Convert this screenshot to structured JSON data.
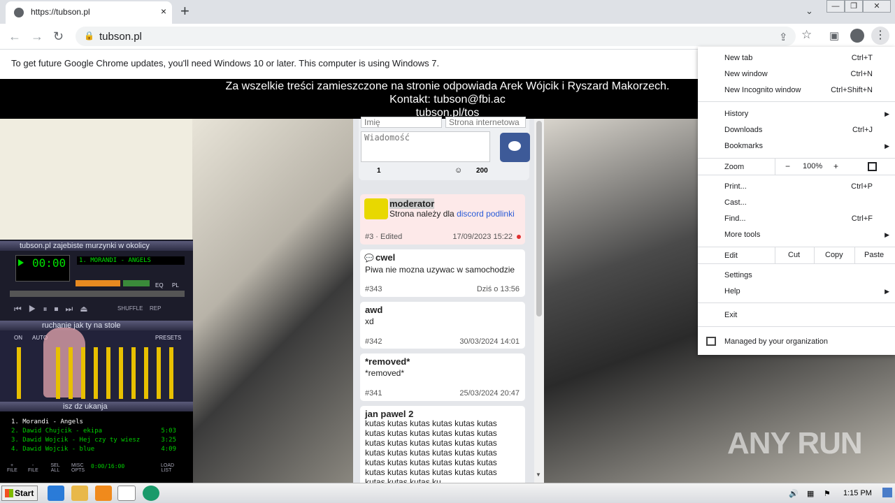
{
  "tab": {
    "title": "https://tubson.pl",
    "close": "×",
    "new_tab": "+"
  },
  "window": {
    "minimize": "—",
    "restore": "❐",
    "close": "✕",
    "tab_search": "⌄"
  },
  "toolbar": {
    "url": "tubson.pl",
    "back": "←",
    "forward": "→",
    "reload": "↻",
    "share": "⇪",
    "star": "☆",
    "sidepanel": "▣",
    "menu": "⋮"
  },
  "infobar": {
    "text": "To get future Google Chrome updates, you'll need Windows 10 or later. This computer is using Windows 7."
  },
  "banner": {
    "line1": "Za wszelkie treści zamieszczone na stronie odpowiada Arek Wójcik i Ryszard Makorzech.",
    "line2": "Kontakt: tubson@fbi.ac",
    "line3": "tubson.pl/tos"
  },
  "chat_form": {
    "name_placeholder": "Imię",
    "site_placeholder": "Strona internetowa",
    "message_placeholder": "Wiadomość",
    "count_left": "1",
    "count_right": "200"
  },
  "messages": [
    {
      "nick": "moderator",
      "text": "Strona należy dla ",
      "link": "discord podlinki",
      "id": "#3 · Edited",
      "date": "17/09/2023 15:22"
    },
    {
      "nick": "cwel",
      "text": "Piwa nie mozna uzywac w samochodzie",
      "id": "#343",
      "date": "Dziś o 13:56"
    },
    {
      "nick": "awd",
      "text": "xd",
      "id": "#342",
      "date": "30/03/2024 14:01"
    },
    {
      "nick": "*removed*",
      "text": "*removed*",
      "id": "#341",
      "date": "25/03/2024 20:47"
    },
    {
      "nick": "jan pawel 2",
      "text": "kutas kutas kutas kutas kutas kutas\nkutas kutas kutas kutas kutas kutas\nkutas kutas kutas kutas kutas kutas\nkutas kutas kutas kutas kutas kutas\nkutas kutas kutas kutas kutas kutas\nkutas kutas kutas kutas kutas kutas\nkutas kutas kutas ku"
    }
  ],
  "winamp": {
    "title": "tubson.pl zajebiste murzynki w okolicy",
    "time": "00:00",
    "song": "1. MORANDI - ANGELS",
    "eq_title": "ruchanie jak ty na stole",
    "eq_on": "ON",
    "eq_auto": "AUTO",
    "eq_presets": "PRESETS",
    "pl_title": "isz dz ukanja",
    "pl_time": "0:00/16:00",
    "shuffle": "SHUFFLE",
    "rep": "REP",
    "eq_btn": "EQ",
    "pl_btn": "PL",
    "playlist": [
      {
        "name": "1. Morandi - Angels",
        "dur": ""
      },
      {
        "name": "2. Dawid Chujcik - ekipa",
        "dur": "5:03"
      },
      {
        "name": "3. Dawid Wojcik - Hej czy ty wiesz",
        "dur": "3:25"
      },
      {
        "name": "4. Dawid Wojcik - blue",
        "dur": "4:09"
      }
    ],
    "pl_buttons": [
      "+ FILE",
      "- FILE",
      "SEL ALL",
      "MISC OPTS",
      "LOAD LIST"
    ]
  },
  "menu": {
    "items": [
      {
        "label": "New tab",
        "shortcut": "Ctrl+T"
      },
      {
        "label": "New window",
        "shortcut": "Ctrl+N"
      },
      {
        "label": "New Incognito window",
        "shortcut": "Ctrl+Shift+N"
      },
      {
        "label": "History",
        "shortcut": ""
      },
      {
        "label": "Downloads",
        "shortcut": "Ctrl+J"
      },
      {
        "label": "Bookmarks",
        "shortcut": ""
      },
      {
        "label": "Print...",
        "shortcut": "Ctrl+P"
      },
      {
        "label": "Cast...",
        "shortcut": ""
      },
      {
        "label": "Find...",
        "shortcut": "Ctrl+F"
      },
      {
        "label": "More tools",
        "shortcut": ""
      },
      {
        "label": "Settings",
        "shortcut": ""
      },
      {
        "label": "Help",
        "shortcut": ""
      },
      {
        "label": "Exit",
        "shortcut": ""
      }
    ],
    "zoom_label": "Zoom",
    "zoom_minus": "−",
    "zoom_value": "100%",
    "zoom_plus": "+",
    "edit_label": "Edit",
    "cut": "Cut",
    "copy": "Copy",
    "paste": "Paste",
    "managed": "Managed by your organization"
  },
  "taskbar": {
    "start": "Start",
    "clock": "1:15 PM"
  },
  "watermark": "ANY RUN"
}
